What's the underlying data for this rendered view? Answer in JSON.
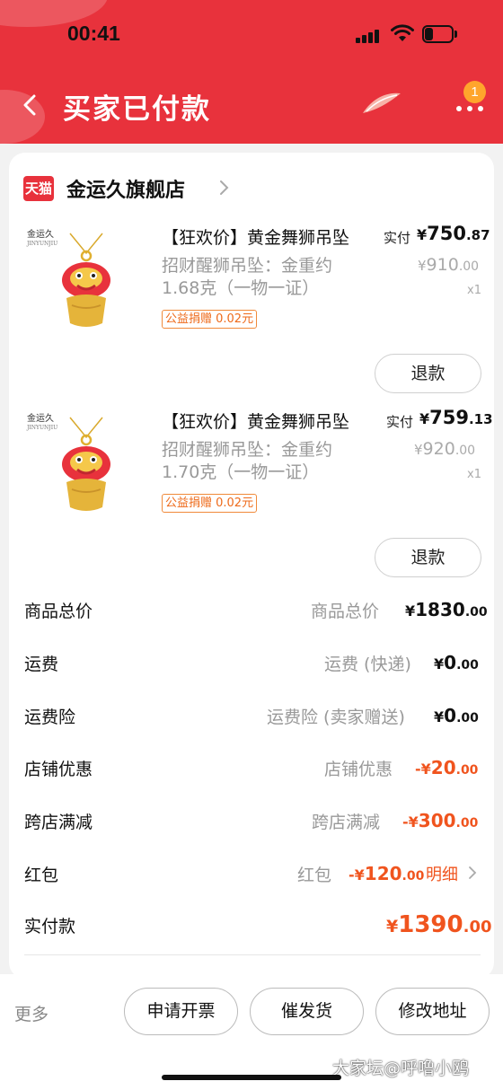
{
  "status_bar": {
    "time": "00:41"
  },
  "header": {
    "title": "买家已付款",
    "more_badge": "1",
    "brand_color": "#e8323c"
  },
  "store": {
    "logo_text": "天猫",
    "name": "金运久旗舰店"
  },
  "products": [
    {
      "brand_mark": "金运久",
      "brand_mark_sub": "JINYUNJIU",
      "title": "【狂欢价】黄金舞狮吊坠",
      "spec": "招财醒狮吊坠：金重约1.68克（一物一证）",
      "charity": "公益捐赠 0.02元",
      "paid_label": "实付",
      "paid_yen": "¥",
      "paid_int": "750",
      "paid_dec": ".87",
      "orig_yen": "¥",
      "orig_int": "910",
      "orig_dec": ".00",
      "qty": "x1",
      "refund_label": "退款"
    },
    {
      "brand_mark": "金运久",
      "brand_mark_sub": "JINYUNJIU",
      "title": "【狂欢价】黄金舞狮吊坠",
      "spec": "招财醒狮吊坠：金重约1.70克（一物一证）",
      "charity": "公益捐赠 0.02元",
      "paid_label": "实付",
      "paid_yen": "¥",
      "paid_int": "759",
      "paid_dec": ".13",
      "orig_yen": "¥",
      "orig_int": "920",
      "orig_dec": ".00",
      "qty": "x1",
      "refund_label": "退款"
    }
  ],
  "fees": [
    {
      "label": "商品总价",
      "desc": "商品总价",
      "yen": "¥",
      "int": "1830",
      "dec": ".00"
    },
    {
      "label": "运费",
      "desc": "运费 (快递)",
      "yen": "¥",
      "int": "0",
      "dec": ".00"
    },
    {
      "label": "运费险",
      "desc": "运费险 (卖家赠送)",
      "yen": "¥",
      "int": "0",
      "dec": ".00"
    },
    {
      "label": "店铺优惠",
      "desc": "店铺优惠",
      "yen": "-¥",
      "int": "20",
      "dec": ".00"
    },
    {
      "label": "跨店满减",
      "desc": "跨店满减",
      "yen": "-¥",
      "int": "300",
      "dec": ".00"
    },
    {
      "label": "红包",
      "desc": "红包",
      "yen": "-¥",
      "int": "120",
      "dec": ".00",
      "link": "明细"
    }
  ],
  "total": {
    "label": "实付款",
    "yen": "¥",
    "int": "1390",
    "dec": ".00"
  },
  "bottom": {
    "more": "更多",
    "invoice": "申请开票",
    "urge": "催发货",
    "address": "修改地址",
    "watermark": "大家坛@呼噜小鸥"
  }
}
